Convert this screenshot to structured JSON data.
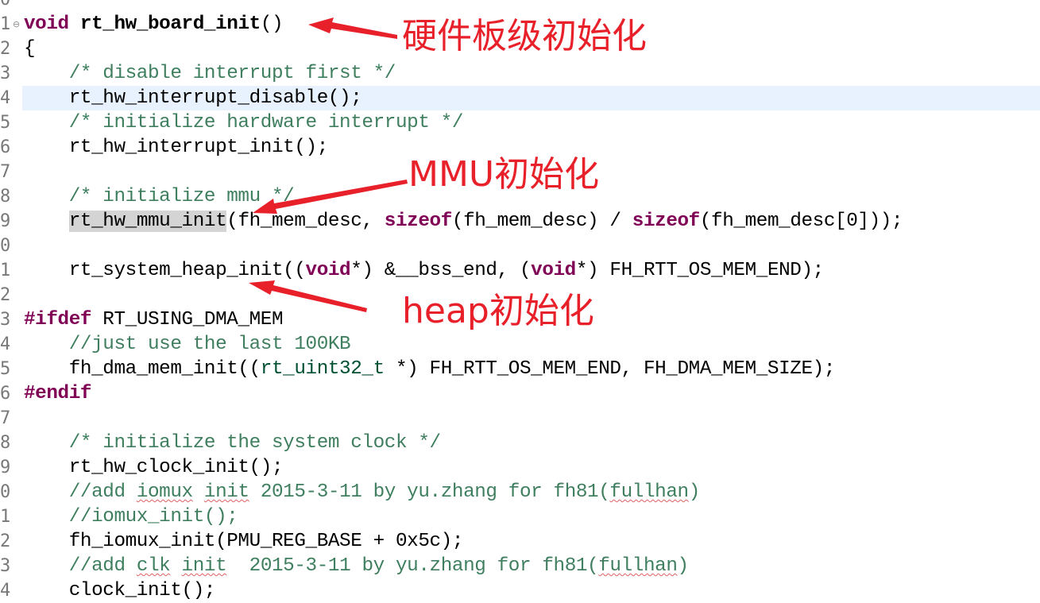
{
  "line_numbers": [
    "0",
    "1",
    "2",
    "3",
    "4",
    "5",
    "6",
    "7",
    "8",
    "9",
    "0",
    "1",
    "2",
    "3",
    "4",
    "5",
    "6",
    "7",
    "8",
    "9",
    "0",
    "1",
    "2",
    "3",
    "4"
  ],
  "fold_marker": "⊖",
  "code": {
    "l1": [
      "void",
      " ",
      "rt_hw_board_init",
      "()"
    ],
    "l2": "{",
    "l3": "    /* disable interrupt first */",
    "l4": "    rt_hw_interrupt_disable();",
    "l5": "    /* initialize hardware interrupt */",
    "l6": "    rt_hw_interrupt_init();",
    "l8": "    /* initialize mmu */",
    "l9": [
      "    ",
      "rt_hw_mmu_init",
      "(fh_mem_desc, ",
      "sizeof",
      "(fh_mem_desc) / ",
      "sizeof",
      "(fh_mem_desc[0]));"
    ],
    "l11": [
      "    rt_system_heap_init((",
      "void",
      "*) &__bss_end, (",
      "void",
      "*) FH_RTT_OS_MEM_END);"
    ],
    "l13": [
      "#ifdef",
      " RT_USING_DMA_MEM"
    ],
    "l14": "    //just use the last 100KB",
    "l15": [
      "    fh_dma_mem_init((",
      "rt_uint32_t",
      " *) FH_RTT_OS_MEM_END, FH_DMA_MEM_SIZE);"
    ],
    "l16": "#endif",
    "l18": "    /* initialize the system clock */",
    "l19": "    rt_hw_clock_init();",
    "l20": [
      "    //add ",
      "iomux",
      " ",
      "init",
      " 2015-3-11 by yu.zhang for fh81(",
      "fullhan",
      ")"
    ],
    "l21": "    //iomux_init();",
    "l22": "    fh_iomux_init(PMU_REG_BASE + 0x5c);",
    "l23": [
      "    //add ",
      "clk",
      " ",
      "init",
      "  2015-3-11 by yu.zhang for fh81(",
      "fullhan",
      ")"
    ],
    "l24": "    clock_init();"
  },
  "annotations": {
    "board": "硬件板级初始化",
    "mmu": "MMU初始化",
    "heap": "heap初始化"
  },
  "colors": {
    "keyword": "#7f0055",
    "comment": "#3f7f5f",
    "annotation": "#e8202a",
    "current_line": "#e8f2fe"
  }
}
